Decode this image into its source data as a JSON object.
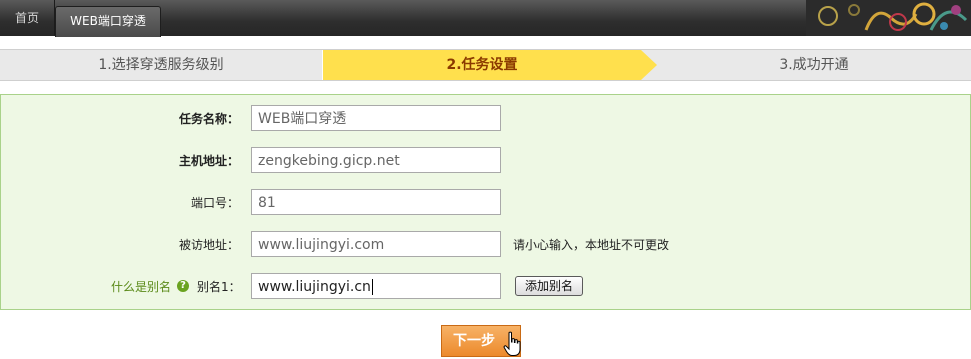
{
  "nav": {
    "home_label": "首页",
    "active_tab_label": "WEB端口穿透"
  },
  "steps": [
    {
      "label": "1.选择穿透服务级别",
      "state": "done"
    },
    {
      "label": "2.任务设置",
      "state": "current"
    },
    {
      "label": "3.成功开通",
      "state": "pending"
    }
  ],
  "form": {
    "task_name": {
      "label": "任务名称：",
      "value": "WEB端口穿透"
    },
    "host": {
      "label": "主机地址：",
      "value": "zengkebing.gicp.net"
    },
    "port": {
      "label": "端口号：",
      "value": "81"
    },
    "visited": {
      "label": "被访地址：",
      "value": "www.liujingyi.com",
      "note": "请小心输入，本地址不可更改"
    },
    "alias": {
      "whatis_label": "什么是别名",
      "label": "别名1：",
      "value": "www.liujingyi.cn",
      "add_button": "添加别名"
    }
  },
  "next_button": "下一步",
  "colors": {
    "topbar": "#333333",
    "active_step": "#ffe04d",
    "panel_bg": "#eef8e4",
    "panel_border": "#a9d28a",
    "next_button": "#f09a3e"
  },
  "icons": {
    "help": "question-circle-icon",
    "cursor": "hand-pointer-icon"
  }
}
